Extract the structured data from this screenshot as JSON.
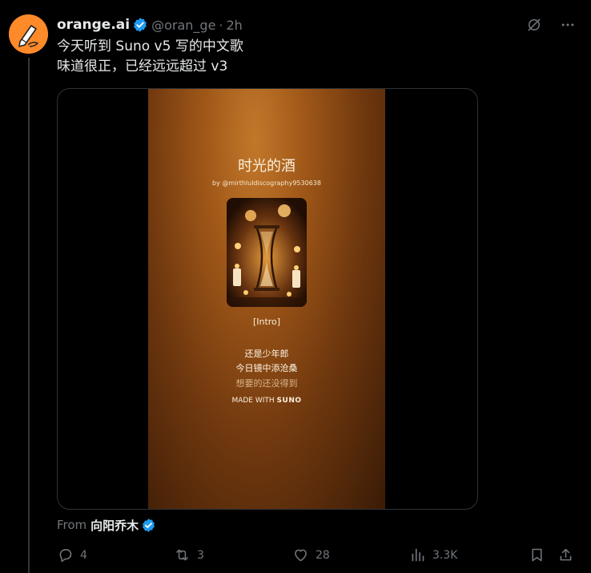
{
  "author": {
    "display_name": "orange.ai",
    "handle": "@oran_ge",
    "separator": "·",
    "time": "2h"
  },
  "tweet": {
    "line1": "今天听到 Suno v5 写的中文歌",
    "line2": "味道很正，已经远远超过 v3"
  },
  "media": {
    "song_title": "时光的酒",
    "byline": "by @mirthluldiscography9530638",
    "section": "[Intro]",
    "lyrics": [
      "还是少年郎",
      "今日镜中添沧桑",
      "想要的还没得到"
    ],
    "made_with_prefix": "MADE WITH",
    "made_with_brand": "SUNO"
  },
  "from": {
    "label": "From",
    "name": "向阳乔木"
  },
  "actions": {
    "replies": "4",
    "reposts": "3",
    "likes": "28",
    "views": "3.3K"
  },
  "icons": {
    "verified": "verified-badge-icon",
    "grok": "grok-icon",
    "more": "more-icon",
    "reply": "reply-icon",
    "repost": "repost-icon",
    "like": "heart-icon",
    "views": "views-icon",
    "bookmark": "bookmark-icon",
    "share": "share-icon"
  },
  "colors": {
    "background": "#000000",
    "text": "#e7e9ea",
    "muted": "#71767b",
    "verified_blue": "#1d9bf0",
    "avatar_orange": "#ff8a2a"
  }
}
